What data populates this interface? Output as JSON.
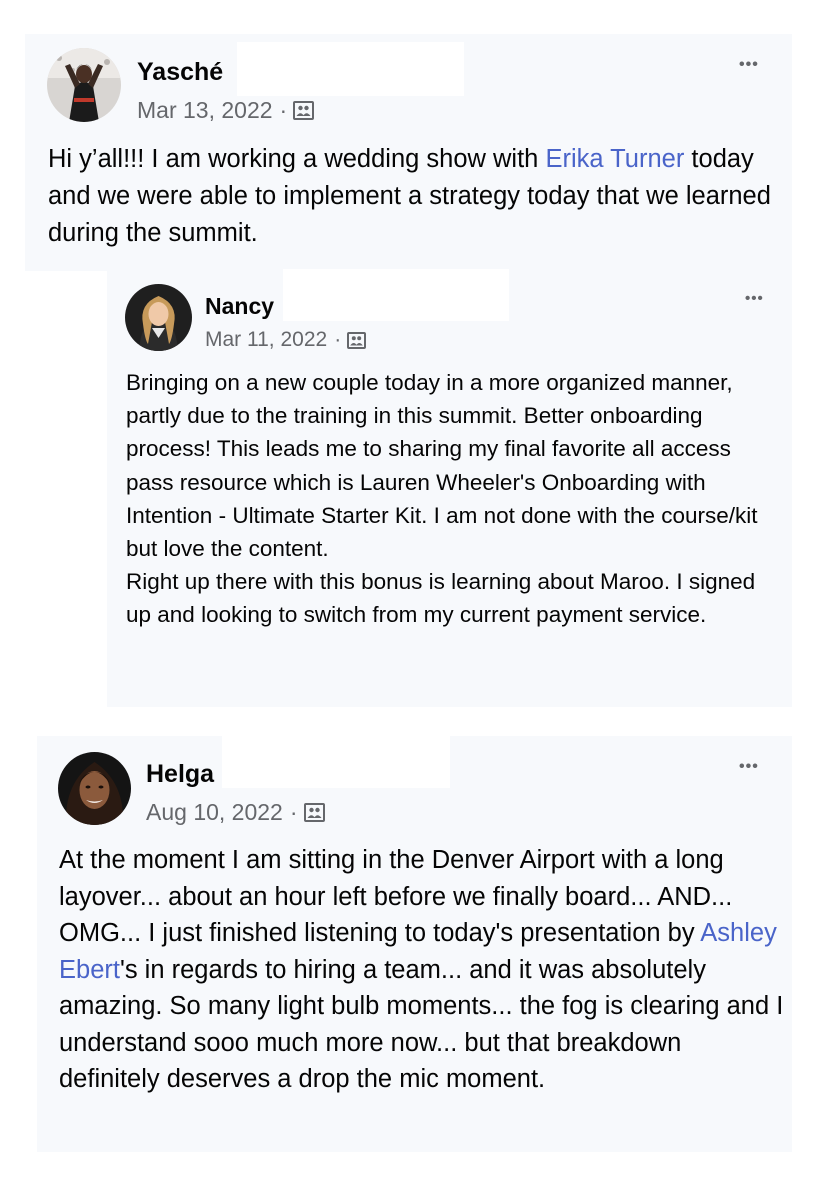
{
  "posts": [
    {
      "author": "Yasché",
      "date": "Mar 13, 2022",
      "meta_separator": "·",
      "privacy_icon": "group-members-icon",
      "more_label": "•••",
      "text_before": "Hi y’all!!! I am working a wedding show with ",
      "mention": "Erika Turner",
      "text_after": " today and we were able to implement a strategy today that we learned during the summit."
    },
    {
      "author": "Nancy",
      "date": "Mar 11, 2022",
      "meta_separator": "·",
      "privacy_icon": "group-members-icon",
      "more_label": "•••",
      "paragraph_1": "Bringing on a new couple today in a more organized manner, partly due to the training in this summit. Better onboarding process! This leads me to sharing my final favorite all access pass resource which is Lauren Wheeler's Onboarding with Intention - Ultimate Starter Kit. I am not done with the course/kit but love the content.",
      "paragraph_2": "Right up there with this bonus is learning about Maroo. I signed up and looking to switch from my current payment service."
    },
    {
      "author": "Helga",
      "date": "Aug 10, 2022",
      "meta_separator": "·",
      "privacy_icon": "group-members-icon",
      "more_label": "•••",
      "text_before": "At the moment I am sitting in the Denver Airport with a long layover... about an hour left before we finally board... AND... OMG... I just finished listening to today's presentation by ",
      "mention": "Ashley Ebert",
      "text_after": "'s in regards to hiring a team... and it was absolutely amazing. So many light bulb moments... the fog is clearing and  I understand sooo much more now... but that breakdown definitely deserves a drop the mic moment."
    }
  ],
  "colors": {
    "card_background": "#f7f9fc",
    "mention": "#4a64c9",
    "meta_text": "#65676b",
    "body_text": "#050505"
  }
}
